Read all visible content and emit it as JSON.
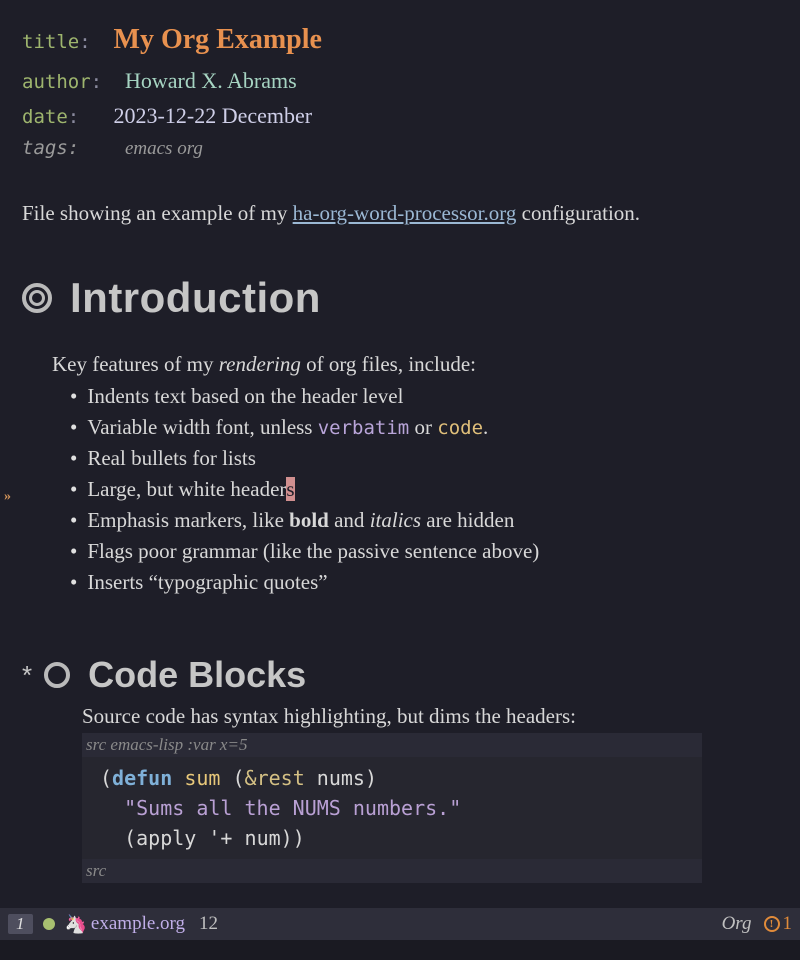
{
  "meta": {
    "title_key": "title",
    "title_val": "My Org Example",
    "author_key": "author",
    "author_val": "Howard X. Abrams",
    "date_key": "date",
    "date_val": "2023-12-22 December",
    "tags_key": "tags:",
    "tags_val": "emacs org"
  },
  "intro": {
    "before_link": "File showing an example of my ",
    "link_text": "ha-org-word-processor.org",
    "after_link": " configuration."
  },
  "h1": "Introduction",
  "features_intro_a": "Key features of my ",
  "features_intro_em": "rendering",
  "features_intro_b": " of org files, include:",
  "bullets": {
    "b1": "Indents text based on the header level",
    "b2a": "Variable width font, unless ",
    "b2_verbatim": "verbatim",
    "b2_or": " or ",
    "b2_code": "code",
    "b2_end": ".",
    "b3": "Real bullets for lists",
    "b4a": "Large, but white header",
    "b4_cursor": "s",
    "b5a": "Emphasis markers, like ",
    "b5_bold": "bold",
    "b5_and": " and ",
    "b5_italic": "italics",
    "b5_end": " are hidden",
    "b6": "Flags poor grammar (like the passive sentence above)",
    "b7": "Inserts “typographic quotes”"
  },
  "h2_star": "*",
  "h2": "Code Blocks",
  "code_intro": "Source code has syntax highlighting, but dims the headers:",
  "src_header_a": "src ",
  "src_header_b": "emacs-lisp :var x=5",
  "src_footer": "src",
  "code": {
    "l1_open": "(",
    "l1_defun": "defun",
    "l1_sp1": " ",
    "l1_name": "sum",
    "l1_sp2": " ",
    "l1_po": "(",
    "l1_rest": "&rest",
    "l1_sp3": " ",
    "l1_arg": "nums",
    "l1_pc": ")",
    "l2_doc": "\"Sums all the NUMS numbers.\"",
    "l3_open": "(",
    "l3_apply": "apply ",
    "l3_q": "'+",
    "l3_sp": " ",
    "l3_num": "num",
    "l3_close": "))"
  },
  "modeline": {
    "window": "1",
    "filename": "example.org",
    "line": "12",
    "mode": "Org",
    "warn_count": "1"
  },
  "fringe": "»"
}
